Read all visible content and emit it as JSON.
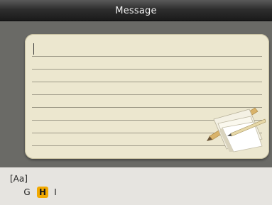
{
  "window": {
    "title": "Message"
  },
  "message": {
    "text": "",
    "icon": "note-paper-icon"
  },
  "keyboard": {
    "mode_label": "[Aa]",
    "keys": [
      {
        "label": "G",
        "selected": false
      },
      {
        "label": "H",
        "selected": true
      },
      {
        "label": "I",
        "selected": false
      }
    ],
    "highlight_color": "#f2a900"
  }
}
